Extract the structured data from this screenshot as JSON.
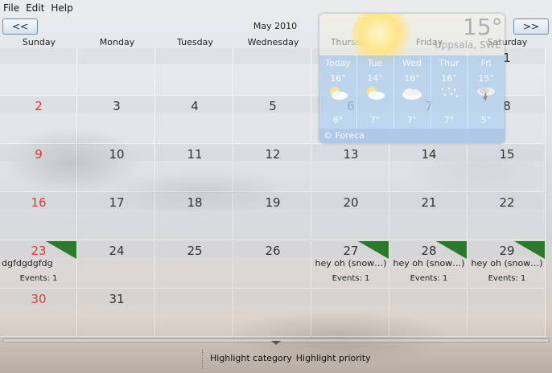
{
  "menu": {
    "items": [
      "File",
      "Edit",
      "Help"
    ]
  },
  "nav": {
    "prev_label": "<<",
    "next_label": ">>"
  },
  "calendar": {
    "month_title": "May 2010",
    "day_headers": [
      "Sunday",
      "Monday",
      "Tuesday",
      "Wednesday",
      "Thursday",
      "Friday",
      "Saturday"
    ],
    "weeks": [
      [
        {
          "d": ""
        },
        {
          "d": ""
        },
        {
          "d": ""
        },
        {
          "d": ""
        },
        {
          "d": ""
        },
        {
          "d": ""
        },
        {
          "d": "1"
        }
      ],
      [
        {
          "d": "2"
        },
        {
          "d": "3"
        },
        {
          "d": "4"
        },
        {
          "d": "5"
        },
        {
          "d": "6"
        },
        {
          "d": "7"
        },
        {
          "d": "8"
        }
      ],
      [
        {
          "d": "9"
        },
        {
          "d": "10"
        },
        {
          "d": "11"
        },
        {
          "d": "12"
        },
        {
          "d": "13"
        },
        {
          "d": "14"
        },
        {
          "d": "15"
        }
      ],
      [
        {
          "d": "16"
        },
        {
          "d": "17"
        },
        {
          "d": "18"
        },
        {
          "d": "19"
        },
        {
          "d": "20"
        },
        {
          "d": "21"
        },
        {
          "d": "22"
        }
      ],
      [
        {
          "d": "23",
          "event": "dgfdgdgfdg",
          "count": "Events: 1",
          "flag": true
        },
        {
          "d": "24"
        },
        {
          "d": "25"
        },
        {
          "d": "26"
        },
        {
          "d": "27",
          "event": "hey oh (snow…)",
          "count": "Events: 1",
          "flag": true
        },
        {
          "d": "28",
          "event": "hey oh (snow…)",
          "count": "Events: 1",
          "flag": true
        },
        {
          "d": "29",
          "event": "hey oh (snow…)",
          "count": "Events: 1",
          "flag": true
        }
      ],
      [
        {
          "d": "30"
        },
        {
          "d": "31"
        },
        {
          "d": ""
        },
        {
          "d": ""
        },
        {
          "d": ""
        },
        {
          "d": ""
        },
        {
          "d": ""
        }
      ]
    ],
    "sunday_color": "#e03a2a",
    "event_flag_color": "#2b7a2b"
  },
  "weather": {
    "temperature": "15°",
    "city": "Uppsala, SWE",
    "forecast": [
      {
        "day": "Today",
        "hi": "16°",
        "lo": "6°",
        "icon": "partly-cloudy-icon"
      },
      {
        "day": "Tue",
        "hi": "14°",
        "lo": "7°",
        "icon": "partly-cloudy-icon"
      },
      {
        "day": "Wed",
        "hi": "16°",
        "lo": "7°",
        "icon": "cloudy-icon"
      },
      {
        "day": "Thur",
        "hi": "16°",
        "lo": "7°",
        "icon": "light-rain-icon"
      },
      {
        "day": "Fri",
        "hi": "15°",
        "lo": "5°",
        "icon": "thunderstorm-icon"
      }
    ],
    "provider": "© Foreca"
  },
  "status": {
    "highlight_category": "Highlight category",
    "highlight_priority": "Highlight priority"
  }
}
